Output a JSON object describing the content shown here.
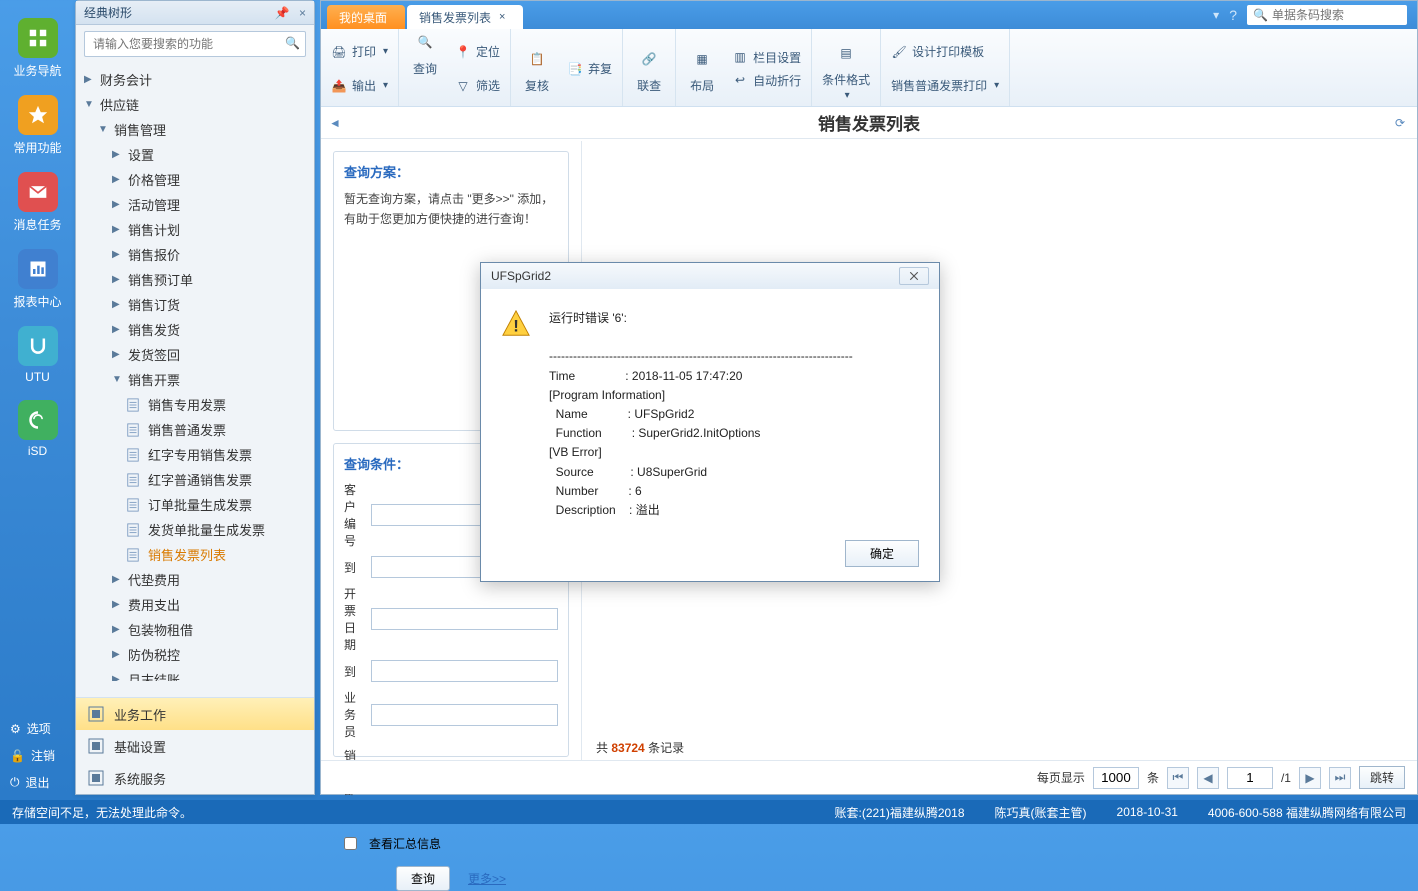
{
  "leftbar": [
    {
      "label": "业务导航",
      "bg": "#5fb030",
      "glyph": "nav"
    },
    {
      "label": "常用功能",
      "bg": "#f0a020",
      "glyph": "star"
    },
    {
      "label": "消息任务",
      "bg": "#e05050",
      "glyph": "mail"
    },
    {
      "label": "报表中心",
      "bg": "#4080d0",
      "glyph": "report"
    },
    {
      "label": "UTU",
      "bg": "#40b0d0",
      "glyph": "utu"
    },
    {
      "label": "iSD",
      "bg": "#40b060",
      "glyph": "isd"
    }
  ],
  "leftbar_bottom": [
    {
      "label": "选项"
    },
    {
      "label": "注销"
    },
    {
      "label": "退出"
    }
  ],
  "tree": {
    "title": "经典树形",
    "search_placeholder": "请输入您要搜索的功能",
    "nodes": [
      {
        "level": 0,
        "arrow": "▶",
        "label": "财务会计"
      },
      {
        "level": 0,
        "arrow": "▼",
        "label": "供应链"
      },
      {
        "level": 1,
        "arrow": "▼",
        "label": "销售管理"
      },
      {
        "level": 2,
        "arrow": "▶",
        "label": "设置"
      },
      {
        "level": 2,
        "arrow": "▶",
        "label": "价格管理"
      },
      {
        "level": 2,
        "arrow": "▶",
        "label": "活动管理"
      },
      {
        "level": 2,
        "arrow": "▶",
        "label": "销售计划"
      },
      {
        "level": 2,
        "arrow": "▶",
        "label": "销售报价"
      },
      {
        "level": 2,
        "arrow": "▶",
        "label": "销售预订单"
      },
      {
        "level": 2,
        "arrow": "▶",
        "label": "销售订货"
      },
      {
        "level": 2,
        "arrow": "▶",
        "label": "销售发货"
      },
      {
        "level": 2,
        "arrow": "▶",
        "label": "发货签回"
      },
      {
        "level": 2,
        "arrow": "▼",
        "label": "销售开票"
      },
      {
        "level": 3,
        "leaf": true,
        "label": "销售专用发票"
      },
      {
        "level": 3,
        "leaf": true,
        "label": "销售普通发票"
      },
      {
        "level": 3,
        "leaf": true,
        "label": "红字专用销售发票"
      },
      {
        "level": 3,
        "leaf": true,
        "label": "红字普通销售发票"
      },
      {
        "level": 3,
        "leaf": true,
        "label": "订单批量生成发票"
      },
      {
        "level": 3,
        "leaf": true,
        "label": "发货单批量生成发票"
      },
      {
        "level": 3,
        "leaf": true,
        "label": "销售发票列表",
        "active": true
      },
      {
        "level": 2,
        "arrow": "▶",
        "label": "代垫费用"
      },
      {
        "level": 2,
        "arrow": "▶",
        "label": "费用支出"
      },
      {
        "level": 2,
        "arrow": "▶",
        "label": "包装物租借"
      },
      {
        "level": 2,
        "arrow": "▶",
        "label": "防伪税控"
      },
      {
        "level": 2,
        "arrow": "▶",
        "label": "月末结账"
      }
    ],
    "bottom": [
      {
        "label": "业务工作",
        "active": true
      },
      {
        "label": "基础设置"
      },
      {
        "label": "系统服务"
      }
    ]
  },
  "tabs": [
    {
      "label": "我的桌面",
      "active": false
    },
    {
      "label": "销售发票列表",
      "active": true,
      "closable": true
    }
  ],
  "topsearch": {
    "placeholder": "单据条码搜索"
  },
  "ribbon": {
    "group1": {
      "print": "打印",
      "output": "输出"
    },
    "group2": {
      "query": "查询",
      "locate": "定位",
      "filter": "筛选"
    },
    "group3": {
      "review": "复核",
      "abandon": "弃复"
    },
    "group4": {
      "union": "联查"
    },
    "group5": {
      "layout": "布局",
      "columns": "栏目设置",
      "wrap": "自动折行"
    },
    "group6": {
      "format": "条件格式"
    },
    "group7": {
      "design": "设计打印模板",
      "print_tpl": "销售普通发票打印"
    }
  },
  "page": {
    "title": "销售发票列表"
  },
  "query_plan": {
    "title": "查询方案：",
    "hint": "暂无查询方案，请点击 \"更多>>\" 添加，有助于您更加方便快捷的进行查询！"
  },
  "query_cond": {
    "title": "查询条件：",
    "fields": {
      "cust": "客户编号",
      "to1": "到",
      "date": "开票日期",
      "to2": "到",
      "sales": "业务员",
      "dept": "销售部门"
    },
    "summary_cb": "查看汇总信息",
    "query_btn": "查询",
    "more": "更多>>"
  },
  "summary": {
    "prefix": "共",
    "count": "83724",
    "suffix": "条记录"
  },
  "pager": {
    "per_label": "每页显示",
    "per_value": "1000",
    "per_unit": "条",
    "page": "1",
    "total": "1",
    "jump": "跳转"
  },
  "dialog": {
    "title": "UFSpGrid2",
    "heading": "运行时错误 '6':",
    "sep": "----------------------------------------------------------------------------",
    "lines": [
      "Time               : 2018-11-05 17:47:20",
      "[Program Information]",
      "  Name            : UFSpGrid2",
      "  Function         : SuperGrid2.InitOptions",
      "[VB Error]",
      "  Source           : U8SuperGrid",
      "  Number         : 6",
      "  Description    : 溢出"
    ],
    "ok": "确定"
  },
  "footer": {
    "msg": "存储空间不足，无法处理此命令。",
    "acct": "账套:(221)福建纵腾2018",
    "user": "陈巧真(账套主管)",
    "date": "2018-10-31",
    "support": "4006-600-588 福建纵腾网络有限公司"
  }
}
